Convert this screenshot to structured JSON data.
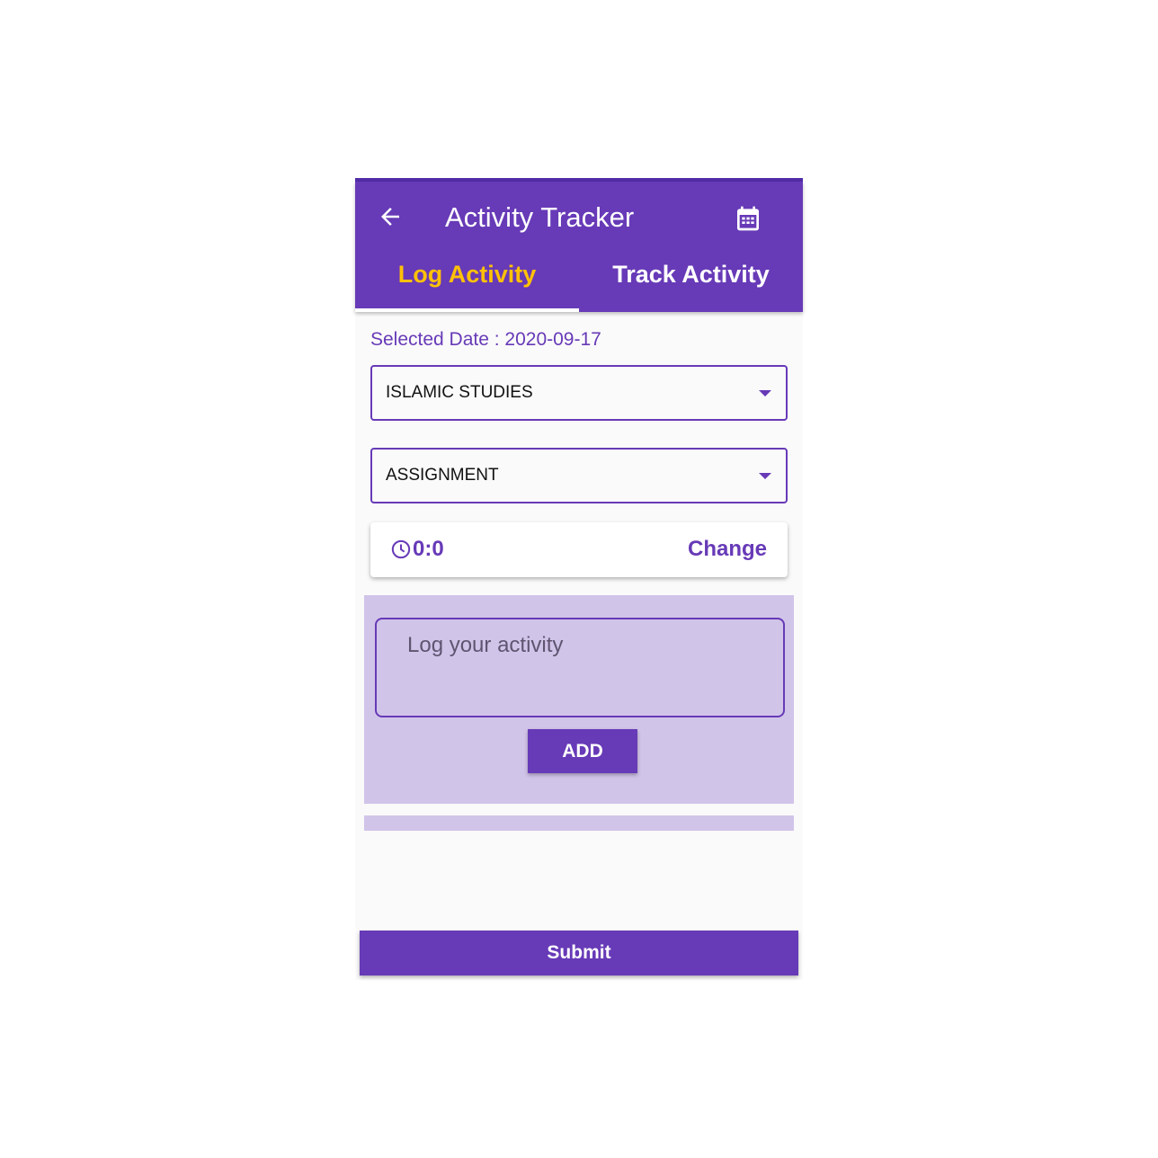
{
  "appbar": {
    "title": "Activity Tracker",
    "back_icon": "arrow-left-icon",
    "calendar_icon": "calendar-icon"
  },
  "tabs": [
    {
      "label": "Log Activity",
      "active": true
    },
    {
      "label": "Track Activity",
      "active": false
    }
  ],
  "selected_date": "Selected Date : 2020-09-17",
  "subject_dropdown": {
    "value": "ISLAMIC STUDIES"
  },
  "type_dropdown": {
    "value": "ASSIGNMENT"
  },
  "time": {
    "value": "0:0",
    "change_label": "Change"
  },
  "log": {
    "placeholder": "Log your activity",
    "add_label": "ADD"
  },
  "submit_label": "Submit",
  "colors": {
    "primary": "#673ab7",
    "accent": "#ffc107",
    "panel": "#d1c4e9"
  }
}
